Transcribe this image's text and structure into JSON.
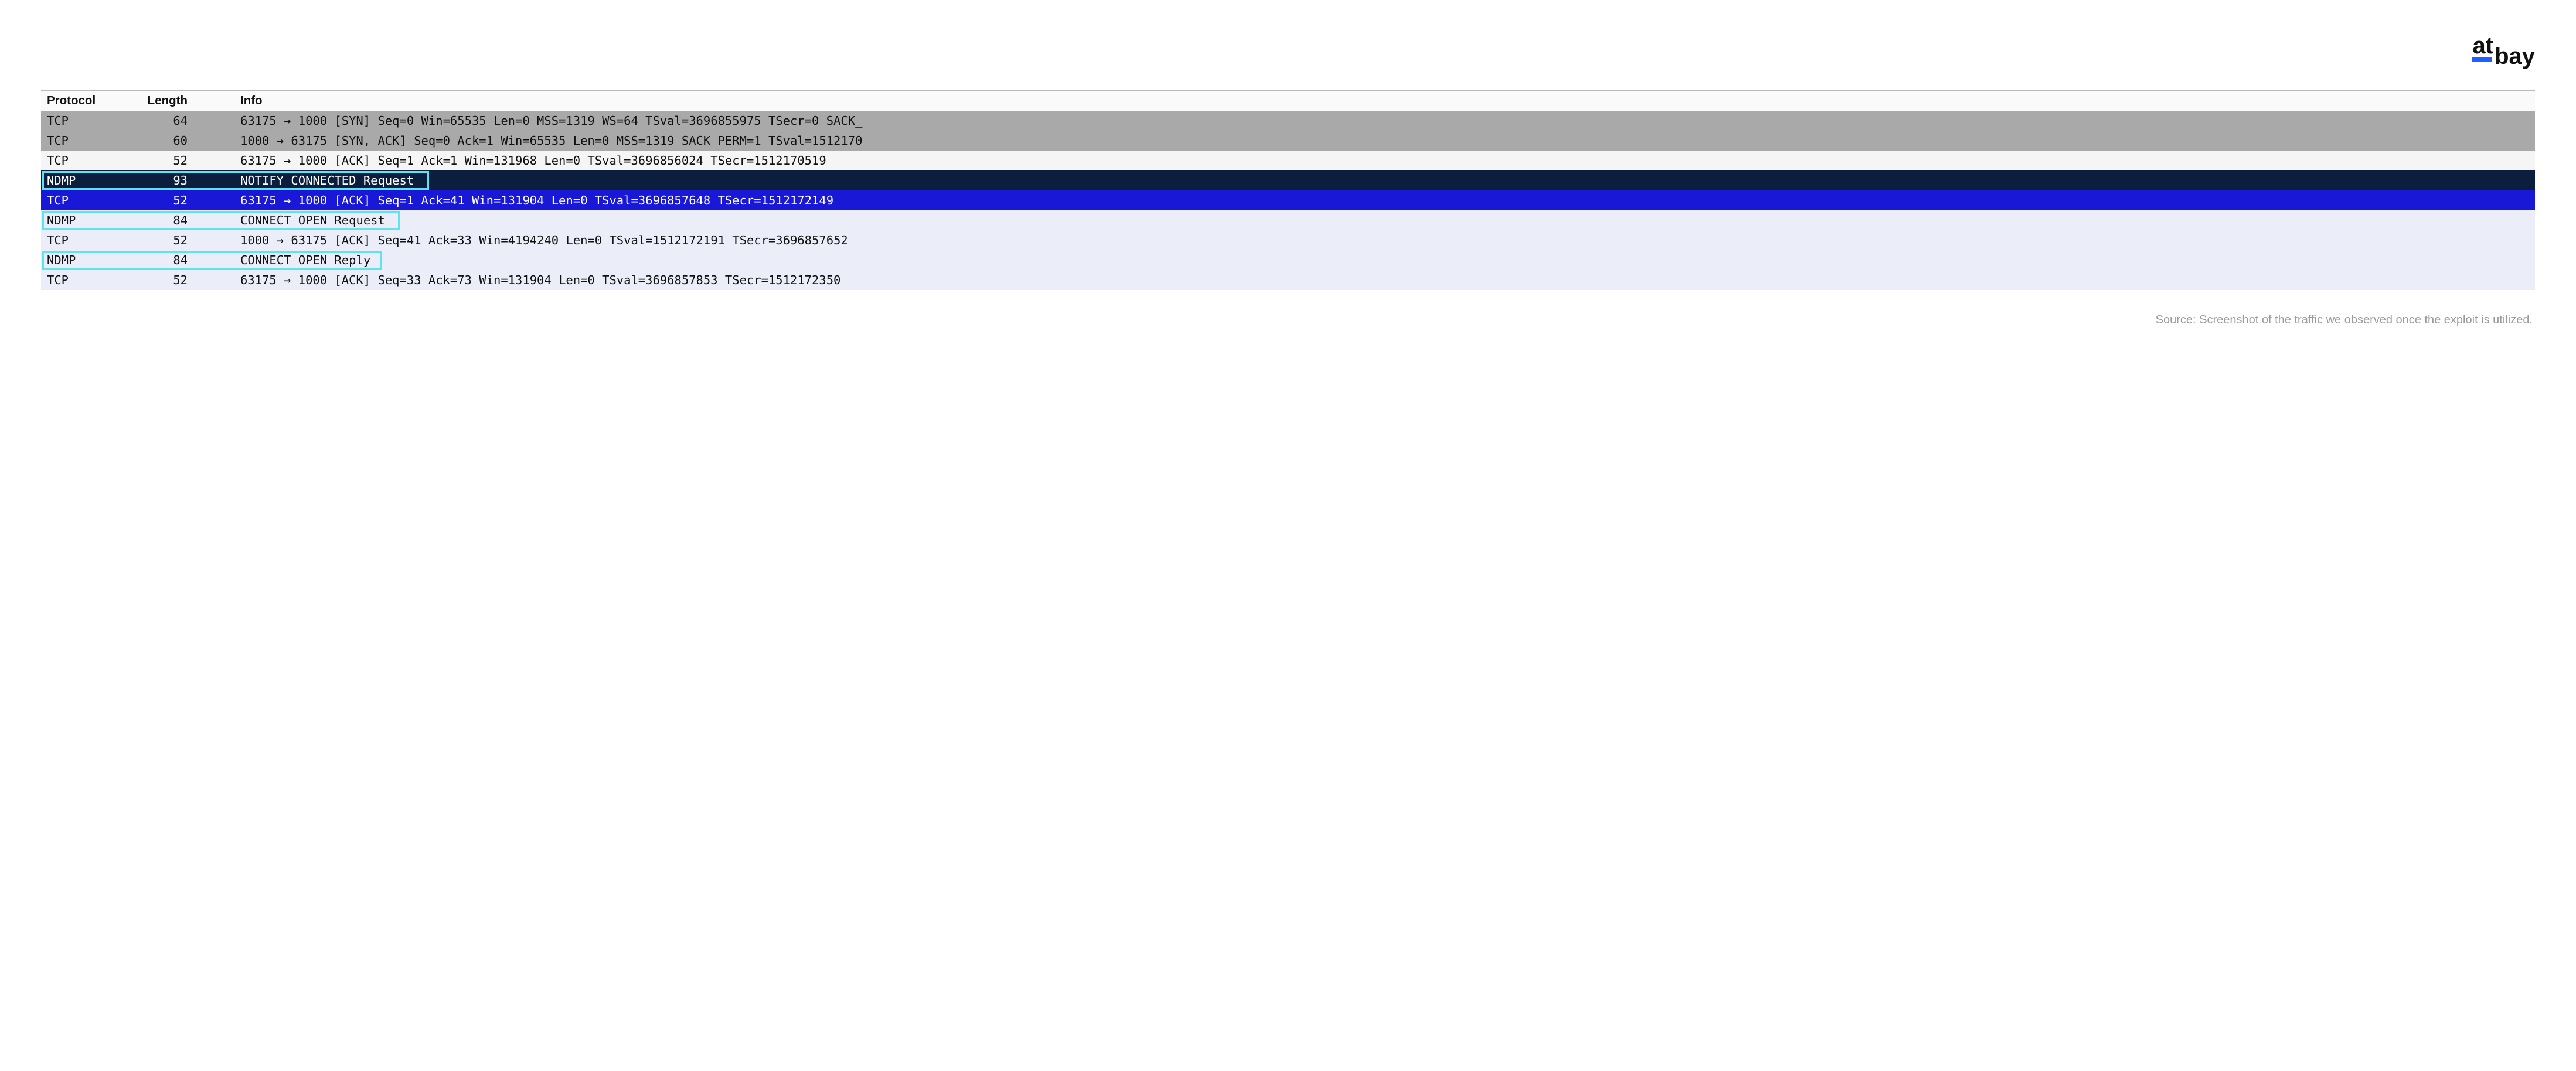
{
  "logo": {
    "part1": "at",
    "part2": "bay"
  },
  "caption": "Source: Screenshot of the traffic we observed once the exploit is utilized.",
  "columns": {
    "protocol": "Protocol",
    "length": "Length",
    "info": "Info"
  },
  "rows": [
    {
      "protocol": "TCP",
      "length": "64",
      "info": "63175 → 1000 [SYN] Seq=0 Win=65535 Len=0 MSS=1319 WS=64 TSval=3696855975 TSecr=0 SACK_",
      "variant": "grey",
      "annotate": false,
      "annoWidth": 0
    },
    {
      "protocol": "TCP",
      "length": "60",
      "info": "1000 → 63175 [SYN, ACK] Seq=0 Ack=1 Win=65535 Len=0 MSS=1319 SACK PERM=1 TSval=1512170",
      "variant": "grey",
      "annotate": false,
      "annoWidth": 0
    },
    {
      "protocol": "TCP",
      "length": "52",
      "info": "63175 → 1000 [ACK] Seq=1 Ack=1 Win=131968 Len=0 TSval=3696856024 TSecr=1512170519",
      "variant": "light",
      "annotate": false,
      "annoWidth": 0
    },
    {
      "protocol": "NDMP",
      "length": "93",
      "info": "NOTIFY_CONNECTED Request",
      "variant": "dark",
      "annotate": true,
      "annoWidth": 660
    },
    {
      "protocol": "TCP",
      "length": "52",
      "info": "63175 → 1000 [ACK] Seq=1 Ack=41 Win=131904 Len=0 TSval=3696857648 TSecr=1512172149",
      "variant": "blue",
      "annotate": false,
      "annoWidth": 0
    },
    {
      "protocol": "NDMP",
      "length": "84",
      "info": "CONNECT_OPEN Request",
      "variant": "pale",
      "annotate": true,
      "annoWidth": 610
    },
    {
      "protocol": "TCP",
      "length": "52",
      "info": "1000 → 63175 [ACK] Seq=41 Ack=33 Win=4194240 Len=0 TSval=1512172191 TSecr=3696857652",
      "variant": "pale",
      "annotate": false,
      "annoWidth": 0
    },
    {
      "protocol": "NDMP",
      "length": "84",
      "info": "CONNECT_OPEN Reply",
      "variant": "pale",
      "annotate": true,
      "annoWidth": 580
    },
    {
      "protocol": "TCP",
      "length": "52",
      "info": "63175 → 1000 [ACK] Seq=33 Ack=73 Win=131904 Len=0 TSval=3696857853 TSecr=1512172350",
      "variant": "pale",
      "annotate": false,
      "annoWidth": 0
    }
  ]
}
